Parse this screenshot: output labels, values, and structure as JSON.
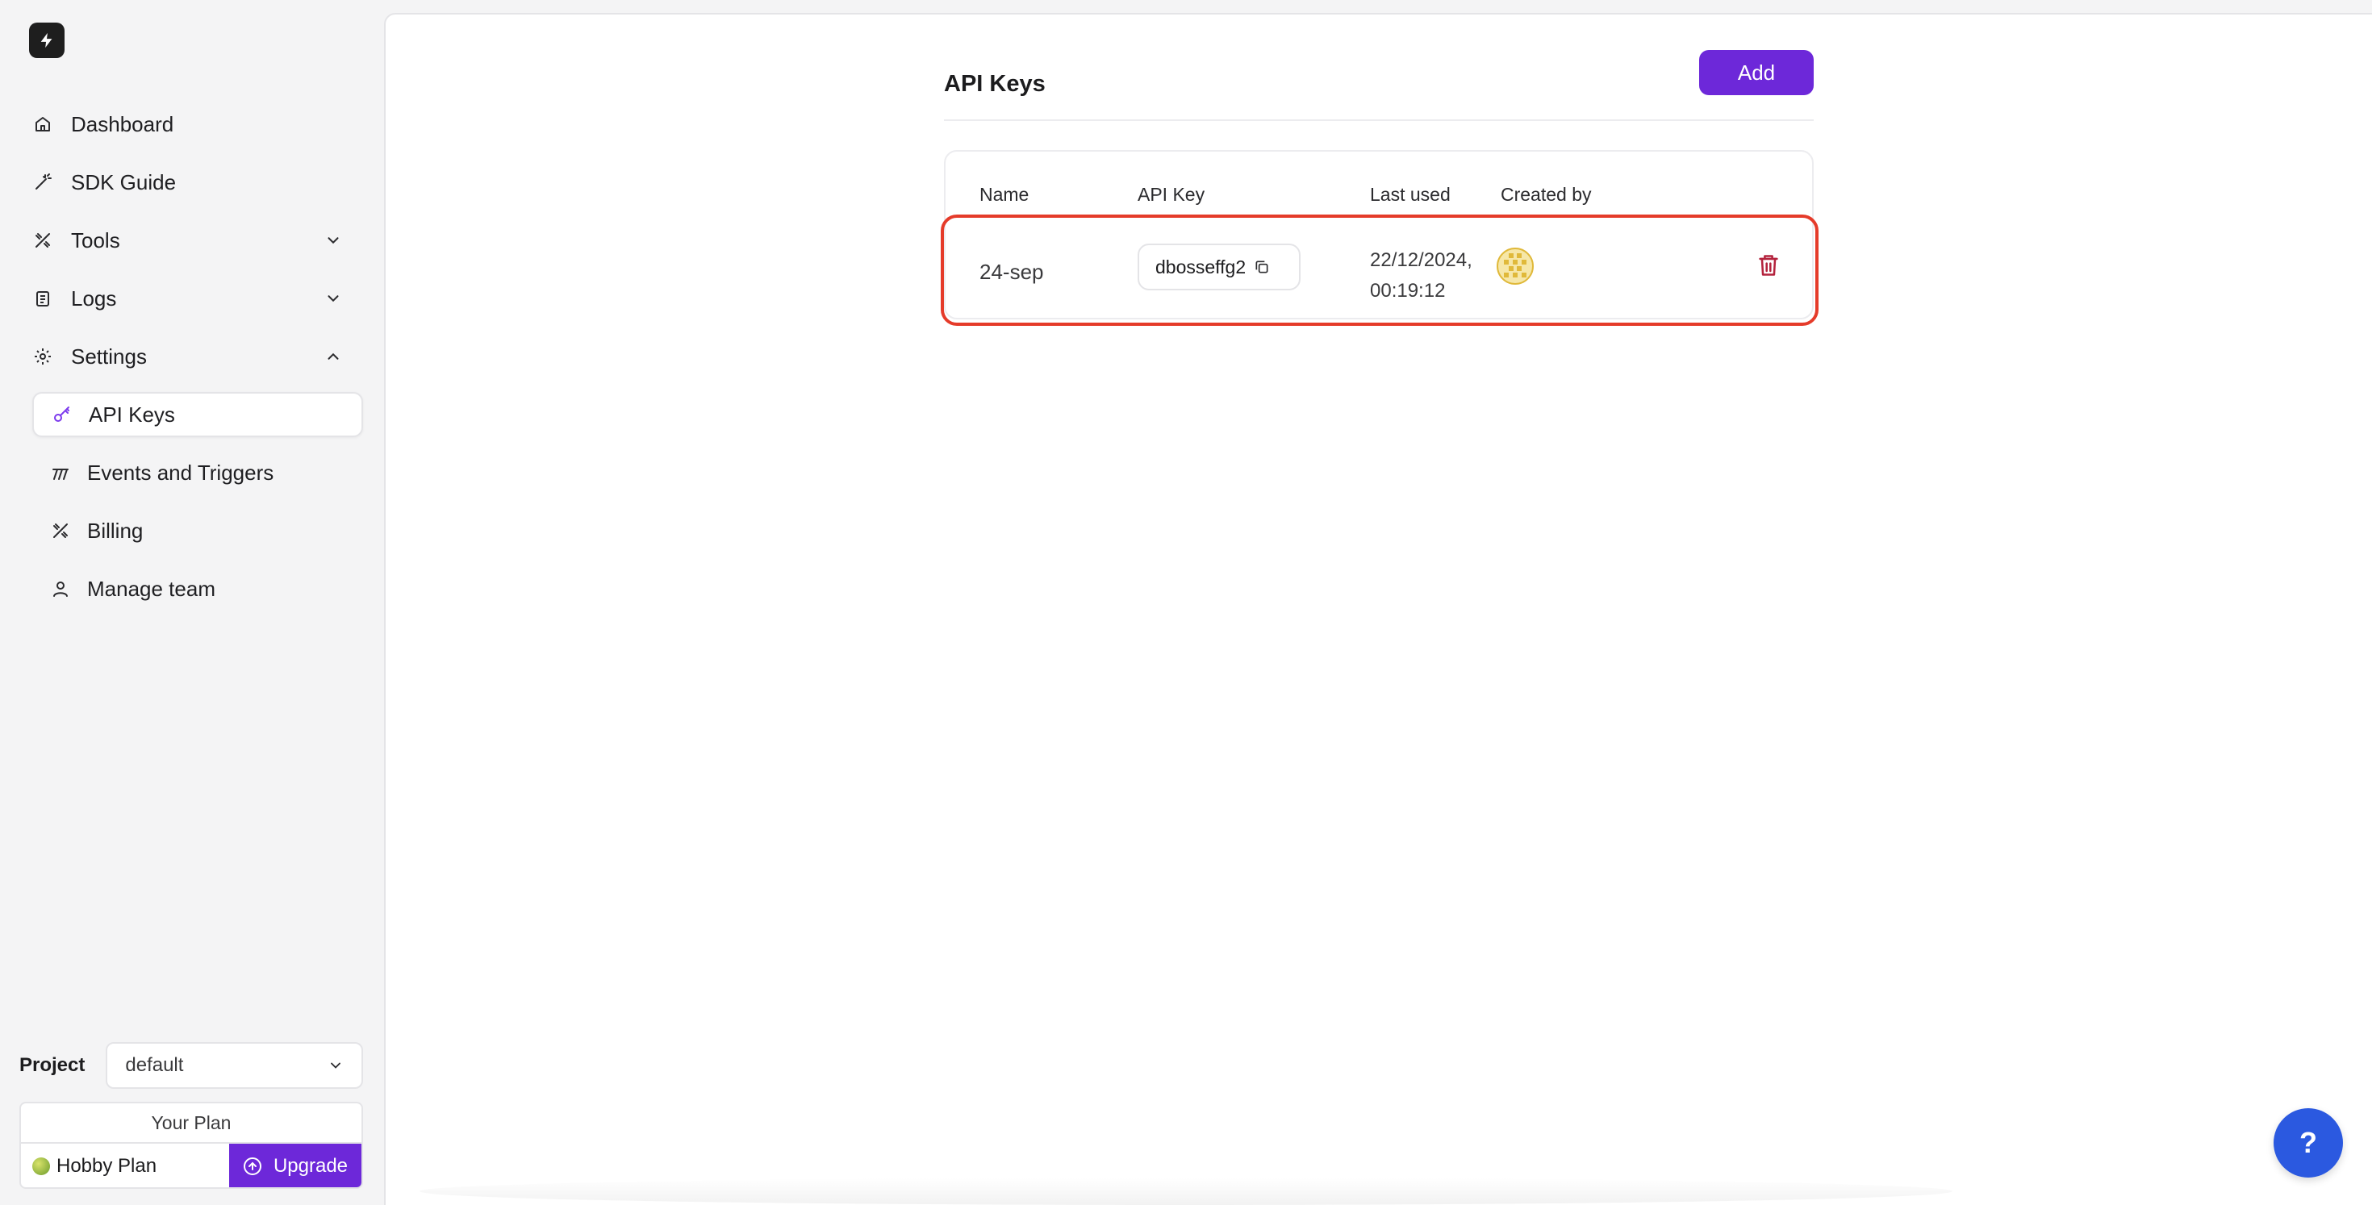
{
  "sidebar": {
    "nav": [
      {
        "label": "Dashboard",
        "icon": "home-icon"
      },
      {
        "label": "SDK Guide",
        "icon": "wand-icon"
      },
      {
        "label": "Tools",
        "icon": "tools-icon"
      },
      {
        "label": "Logs",
        "icon": "clipboard-icon"
      },
      {
        "label": "Settings",
        "icon": "gear-icon"
      }
    ],
    "settings_sub": [
      {
        "label": "API Keys",
        "icon": "key-icon"
      },
      {
        "label": "Events and Triggers",
        "icon": "triggers-icon"
      },
      {
        "label": "Billing",
        "icon": "billing-icon"
      },
      {
        "label": "Manage team",
        "icon": "user-icon"
      }
    ],
    "project_label": "Project",
    "project_value": "default",
    "plan_title": "Your Plan",
    "plan_name": "Hobby Plan",
    "upgrade_label": "Upgrade"
  },
  "main": {
    "title": "API Keys",
    "add_label": "Add",
    "columns": [
      "Name",
      "API Key",
      "Last used",
      "Created by"
    ],
    "rows": [
      {
        "name": "24-sep",
        "api_key": "dbosseffg2",
        "last_used_date": "22/12/2024,",
        "last_used_time": "00:19:12"
      }
    ]
  },
  "help_label": "?",
  "colors": {
    "accent": "#6d28d9",
    "highlight": "#e53b2a",
    "help": "#2b59e0",
    "delete": "#b4233d"
  }
}
